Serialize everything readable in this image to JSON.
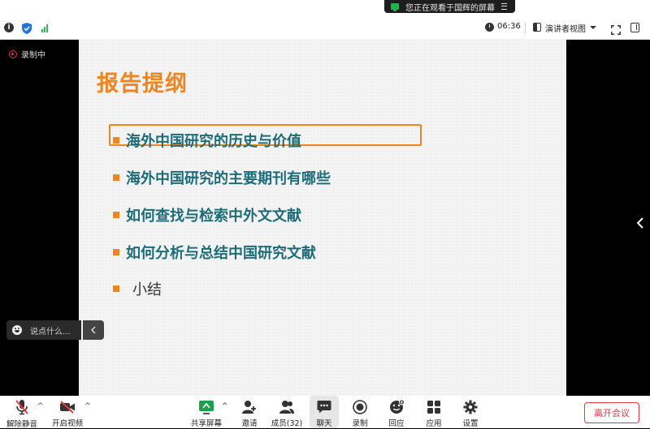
{
  "banner": {
    "share_text": "您正在观看于国辉的屏幕",
    "icon": "screen-share-icon",
    "icon_color": "#22b14c"
  },
  "toolbar": {
    "timer": "06:36",
    "view_label": "演讲者视图",
    "icons": [
      "info-icon",
      "shield-icon",
      "signal-icon",
      "clock-icon",
      "speaker-view-icon",
      "fullscreen-icon",
      "side-panel-icon"
    ]
  },
  "recording": {
    "label": "录制中",
    "color": "#e8383d"
  },
  "slide": {
    "title": "报告提纲",
    "bullets": [
      "海外中国研究的历史与价值",
      "海外中国研究的主要期刊有哪些",
      "如何查找与检索中外文文献",
      "如何分析与总结中国研究文献",
      "小结"
    ],
    "accent_color": "#f0841e",
    "text_color": "#1d6c7a"
  },
  "chat": {
    "placeholder": "说点什么..."
  },
  "bottom": {
    "unmute": "解除静音",
    "start_video": "开启视频",
    "share_screen": "共享屏幕",
    "invite": "邀请",
    "participants": "成员(32)",
    "chat": "聊天",
    "record": "录制",
    "reactions": "回应",
    "apps": "应用",
    "settings": "设置",
    "leave": "离开会议"
  }
}
